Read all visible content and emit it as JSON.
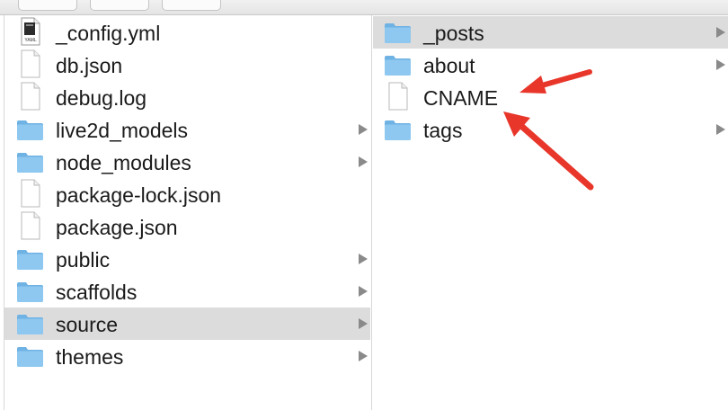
{
  "left_column": {
    "items": [
      {
        "label": "_config.yml",
        "type": "yaml",
        "has_children": false,
        "selected": false
      },
      {
        "label": "db.json",
        "type": "file",
        "has_children": false,
        "selected": false
      },
      {
        "label": "debug.log",
        "type": "file",
        "has_children": false,
        "selected": false
      },
      {
        "label": "live2d_models",
        "type": "folder",
        "has_children": true,
        "selected": false
      },
      {
        "label": "node_modules",
        "type": "folder",
        "has_children": true,
        "selected": false
      },
      {
        "label": "package-lock.json",
        "type": "file",
        "has_children": false,
        "selected": false
      },
      {
        "label": "package.json",
        "type": "file",
        "has_children": false,
        "selected": false
      },
      {
        "label": "public",
        "type": "folder",
        "has_children": true,
        "selected": false
      },
      {
        "label": "scaffolds",
        "type": "folder",
        "has_children": true,
        "selected": false
      },
      {
        "label": "source",
        "type": "folder",
        "has_children": true,
        "selected": true
      },
      {
        "label": "themes",
        "type": "folder",
        "has_children": true,
        "selected": false
      }
    ]
  },
  "right_column": {
    "items": [
      {
        "label": "_posts",
        "type": "folder",
        "has_children": true,
        "selected": true
      },
      {
        "label": "about",
        "type": "folder",
        "has_children": true,
        "selected": false
      },
      {
        "label": "CNAME",
        "type": "file",
        "has_children": false,
        "selected": false
      },
      {
        "label": "tags",
        "type": "folder",
        "has_children": true,
        "selected": false
      }
    ]
  },
  "yaml_icon_text": "YAML",
  "colors": {
    "selection": "#dcdcdc",
    "folder": "#8ec8f0",
    "folder_dark": "#6fb2e4",
    "annotation_arrow": "#e8362a",
    "chevron": "#8a8a8a"
  }
}
